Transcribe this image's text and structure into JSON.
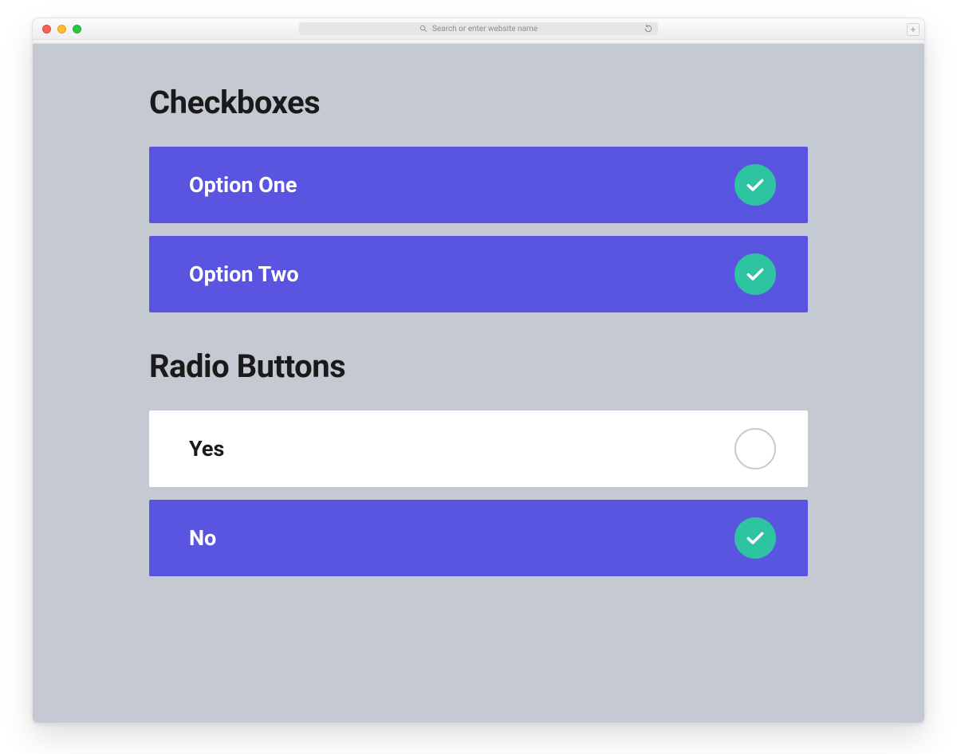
{
  "chrome": {
    "address_placeholder": "Search or enter website name",
    "newtab_label": "+"
  },
  "sections": {
    "checkboxes": {
      "title": "Checkboxes",
      "items": [
        {
          "label": "Option One",
          "checked": true
        },
        {
          "label": "Option Two",
          "checked": true
        }
      ]
    },
    "radios": {
      "title": "Radio Buttons",
      "items": [
        {
          "label": "Yes",
          "checked": false
        },
        {
          "label": "No",
          "checked": true
        }
      ]
    }
  },
  "colors": {
    "accent": "#5a55e0",
    "check": "#2ec4a1",
    "page_bg": "#c5cad2"
  }
}
